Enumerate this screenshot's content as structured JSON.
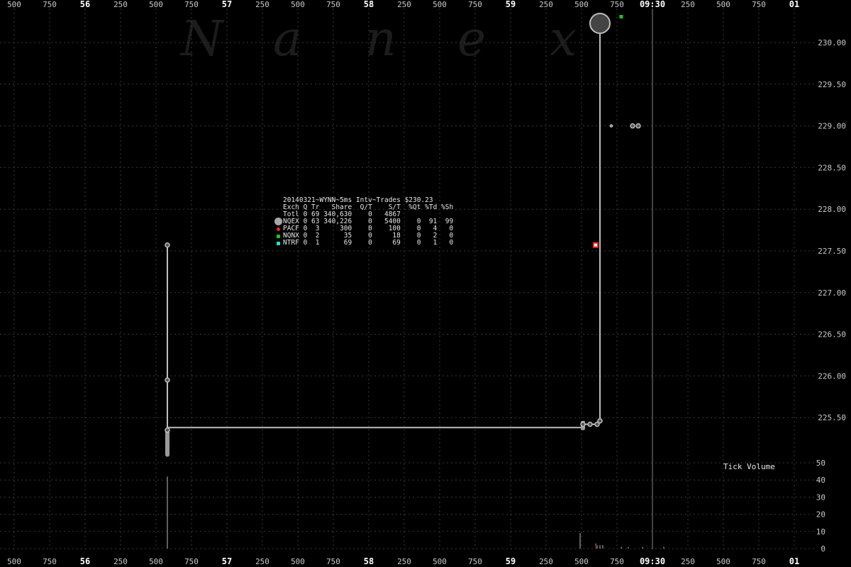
{
  "watermark": [
    "N",
    "a",
    "n",
    "e",
    "x"
  ],
  "time_axis": [
    {
      "label": "500",
      "major": false
    },
    {
      "label": "750",
      "major": false
    },
    {
      "label": "56",
      "major": true
    },
    {
      "label": "250",
      "major": false
    },
    {
      "label": "500",
      "major": false
    },
    {
      "label": "750",
      "major": false
    },
    {
      "label": "57",
      "major": true
    },
    {
      "label": "250",
      "major": false
    },
    {
      "label": "500",
      "major": false
    },
    {
      "label": "750",
      "major": false
    },
    {
      "label": "58",
      "major": true
    },
    {
      "label": "250",
      "major": false
    },
    {
      "label": "500",
      "major": false
    },
    {
      "label": "750",
      "major": false
    },
    {
      "label": "59",
      "major": true
    },
    {
      "label": "250",
      "major": false
    },
    {
      "label": "500",
      "major": false
    },
    {
      "label": "750",
      "major": false
    },
    {
      "label": "09:30",
      "major": true
    },
    {
      "label": "250",
      "major": false
    },
    {
      "label": "500",
      "major": false
    },
    {
      "label": "750",
      "major": false
    },
    {
      "label": "01",
      "major": true
    }
  ],
  "stats": {
    "header": "20140321~WYNN~5ms Intv~Trades $230.23",
    "columns": "Exch Q Tr   Share  Q/T    S/T  %Qt %Td %Sh",
    "rows": [
      {
        "text": "Totl 0 69 340,630    0   4867",
        "marker": "none",
        "color": ""
      },
      {
        "text": "NQEX 0 63 340,226    0   5400    0  91  99",
        "marker": "circle",
        "color": "#a8a8a8"
      },
      {
        "text": "PACF 0  3     300    0    100    0   4   0",
        "marker": "dot",
        "color": "#ff2020"
      },
      {
        "text": "NQNX 0  2      35    0     18    0   2   0",
        "marker": "square",
        "color": "#20c020"
      },
      {
        "text": "NTRF 0  1      69    0     69    0   1   0",
        "marker": "square",
        "color": "#20e0c0"
      }
    ]
  },
  "tick_volume_label": "Tick Volume",
  "chart_data": {
    "type": "scatter",
    "title": "20140321~WYNN~5ms Intv~Trades $230.23",
    "price_axis": {
      "ticks": [
        "230.00",
        "229.50",
        "229.00",
        "228.50",
        "228.00",
        "227.50",
        "227.00",
        "226.50",
        "226.00",
        "225.50"
      ],
      "ylim": [
        225.13,
        230.32
      ]
    },
    "volume_axis": {
      "ticks": [
        "50",
        "40",
        "30",
        "20",
        "10",
        "0"
      ],
      "ylim": [
        0,
        50
      ]
    },
    "price_line": [
      {
        "t": 0.0,
        "p": 227.57
      },
      {
        "t": 0.0,
        "p": 225.05
      },
      {
        "t": 0.0,
        "p": 225.35
      },
      {
        "t": 0.0,
        "p": 225.35
      },
      {
        "t": 0.0,
        "p": 225.38
      },
      {
        "t": 2.93,
        "p": 225.38
      },
      {
        "t": 2.93,
        "p": 225.42
      },
      {
        "t": 3.04,
        "p": 225.42
      },
      {
        "t": 3.04,
        "p": 225.46
      },
      {
        "t": 3.05,
        "p": 225.46
      },
      {
        "t": 3.05,
        "p": 230.23
      }
    ],
    "trades": [
      {
        "t": 0.0,
        "p": 227.57,
        "ex": "NQEX",
        "size": "s"
      },
      {
        "t": 0.0,
        "p": 225.95,
        "ex": "NQEX",
        "size": "s"
      },
      {
        "t": 0.0,
        "p": 225.35,
        "ex": "NQEX",
        "size": "s"
      },
      {
        "t": 2.93,
        "p": 225.42,
        "ex": "NQEX",
        "size": "s"
      },
      {
        "t": 2.98,
        "p": 225.42,
        "ex": "NQEX",
        "size": "s"
      },
      {
        "t": 3.03,
        "p": 225.42,
        "ex": "NQEX",
        "size": "s"
      },
      {
        "t": 3.05,
        "p": 225.46,
        "ex": "NQEX",
        "size": "s"
      },
      {
        "t": 3.02,
        "p": 227.57,
        "ex": "PACF",
        "size": "s"
      },
      {
        "t": 3.05,
        "p": 230.23,
        "ex": "NQEX",
        "size": "l"
      },
      {
        "t": 3.13,
        "p": 229.0,
        "ex": "NQEX",
        "size": "t"
      },
      {
        "t": 3.28,
        "p": 229.0,
        "ex": "NQEX",
        "size": "s"
      },
      {
        "t": 3.32,
        "p": 229.0,
        "ex": "NQEX",
        "size": "s"
      },
      {
        "t": 3.2,
        "p": 230.31,
        "ex": "NQNX",
        "size": "s"
      }
    ],
    "volume": [
      {
        "t": 0.0,
        "v": 42
      },
      {
        "t": 2.91,
        "v": 9
      },
      {
        "t": 3.02,
        "v": 3
      },
      {
        "t": 3.03,
        "v": 2
      },
      {
        "t": 3.05,
        "v": 2
      },
      {
        "t": 3.07,
        "v": 2
      },
      {
        "t": 3.2,
        "v": 1
      },
      {
        "t": 3.25,
        "v": 1
      },
      {
        "t": 3.35,
        "v": 1
      },
      {
        "t": 3.5,
        "v": 1
      }
    ],
    "grid": true,
    "legend": "top-center"
  }
}
